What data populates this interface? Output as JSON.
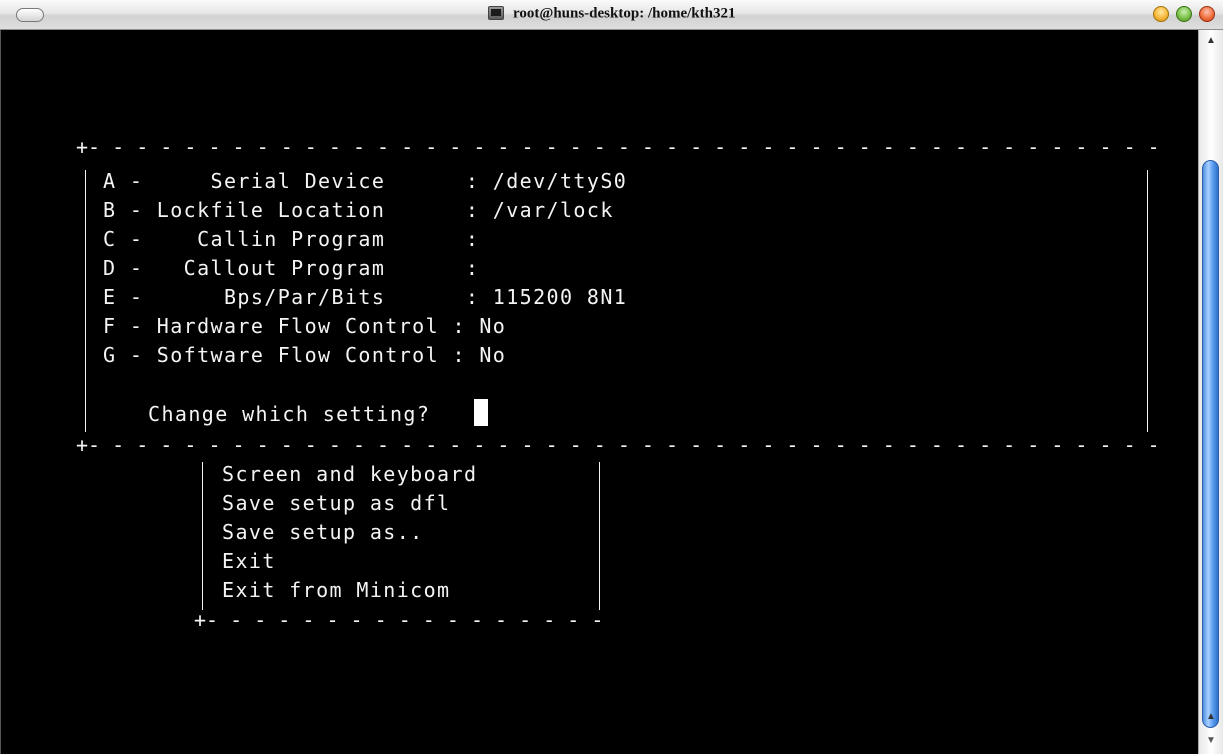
{
  "window": {
    "title": "root@huns-desktop: /home/kth321"
  },
  "terminal": {
    "settings": [
      {
        "label": "A -     Serial Device      : /dev/ttyS0"
      },
      {
        "label": "B - Lockfile Location      : /var/lock"
      },
      {
        "label": "C -    Callin Program      :"
      },
      {
        "label": "D -   Callout Program      :"
      },
      {
        "label": "E -      Bps/Par/Bits      : 115200 8N1"
      },
      {
        "label": "F - Hardware Flow Control : No"
      },
      {
        "label": "G - Software Flow Control : No"
      }
    ],
    "prompt": "Change which setting?",
    "menu": [
      "Screen and keyboard",
      "Save setup as dfl",
      "Save setup as..",
      "Exit",
      "Exit from Minicom"
    ]
  },
  "colors": {
    "terminal_bg": "#000000",
    "terminal_fg": "#f4f4f4",
    "scroll_thumb": "#5c9ef0"
  },
  "icons": {
    "titlebar": "terminal-icon",
    "close": "close-icon",
    "minimize": "minimize-icon",
    "zoom": "zoom-icon"
  }
}
